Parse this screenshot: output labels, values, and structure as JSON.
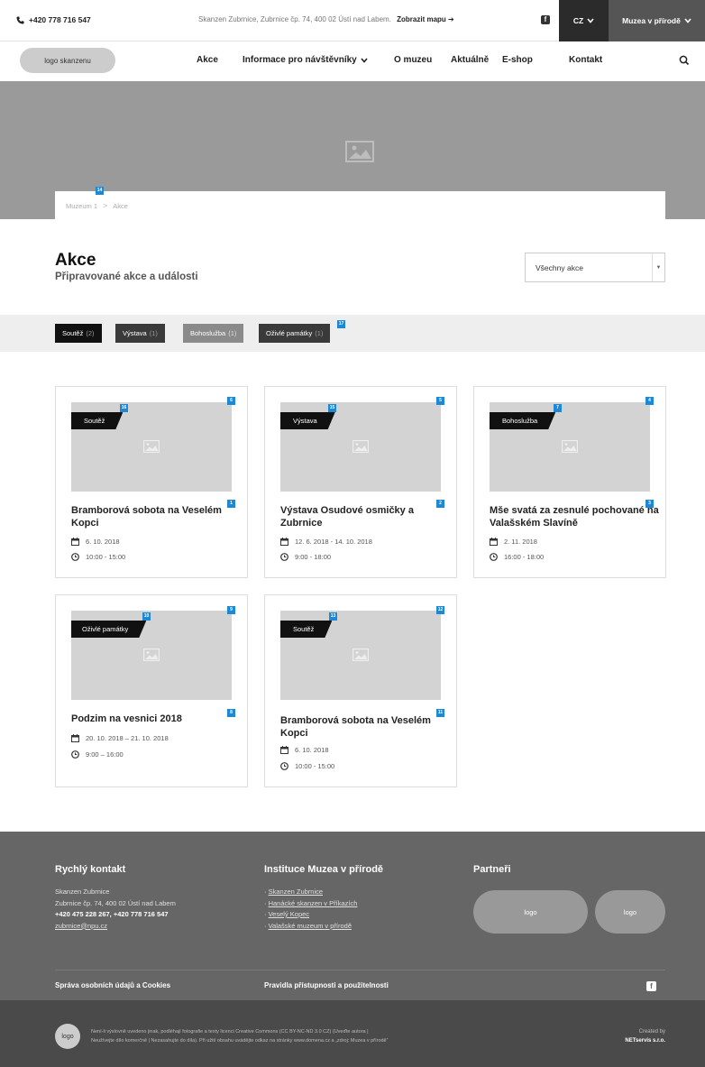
{
  "topbar": {
    "phone": "+420 778 716 547",
    "address": "Skanzen Zubrnice, Zubrnice čp. 74, 400 02 Ústí nad Labem.",
    "map_link": "Zobrazit mapu",
    "language": "CZ",
    "network": "Muzea v přírodě"
  },
  "nav": {
    "logo": "logo skanzenu",
    "items": [
      "Akce",
      "Informace pro návštěvníky",
      "O muzeu",
      "Aktuálně",
      "E-shop",
      "Kontakt"
    ]
  },
  "breadcrumb": {
    "home": "Muzeum 1",
    "current": "Akce"
  },
  "page": {
    "title": "Akce",
    "subtitle": "Připravované akce a události",
    "filter_select": "Všechny akce"
  },
  "filters": [
    {
      "label": "Soutěž",
      "count": "(2)"
    },
    {
      "label": "Výstava",
      "count": "(1)"
    },
    {
      "label": "Bohoslužba",
      "count": "(1)"
    },
    {
      "label": "Oživlé památky",
      "count": "(1)"
    }
  ],
  "events": [
    {
      "category": "Soutěž",
      "title": "Bramborová sobota na Veselém Kopci",
      "date": "6. 10. 2018",
      "time": "10:00 - 15:00"
    },
    {
      "category": "Výstava",
      "title": "Výstava Osudové osmičky a Zubrnice",
      "date": "12. 6. 2018 - 14. 10. 2018",
      "time": "9:00 - 18:00"
    },
    {
      "category": "Bohoslužba",
      "title": "Mše svatá za zesnulé pochované na Valašském Slavíně",
      "date": "2. 11. 2018",
      "time": "16:00 - 18:00"
    },
    {
      "category": "Oživlé památky",
      "title": "Podzim na vesnici 2018",
      "date": "20. 10. 2018 – 21. 10. 2018",
      "time": "9:00 – 16:00"
    },
    {
      "category": "Soutěž",
      "title": "Bramborová sobota na Veselém Kopci",
      "date": "6. 10. 2018",
      "time": "10:00 - 15:00"
    }
  ],
  "badges": [
    "14",
    "16",
    "6",
    "1",
    "15",
    "5",
    "2",
    "7",
    "4",
    "3",
    "10",
    "9",
    "8",
    "13",
    "12",
    "11",
    "17"
  ],
  "footer": {
    "contact_heading": "Rychlý kontakt",
    "contact_name": "Skanzen Zubrnice",
    "contact_address": "Zubrnice čp. 74, 400 02 Ústí nad Labem",
    "contact_phones": "+420 475 228 267, +420 778 716 547",
    "contact_email": "zubrnice@npu.cz",
    "institutions_heading": "Instituce Muzea v přírodě",
    "institutions": [
      "Skanzen Zubrnice",
      "Hanácké skanzen v Příkazích",
      "Veselý Kopec",
      "Valašské muzeum v přírodě"
    ],
    "partners_heading": "Partneři",
    "partner_logos": [
      "logo",
      "logo"
    ],
    "privacy_link": "Správa osobních údajů a Cookies",
    "accessibility_link": "Pravidla přístupnosti a použitelnosti"
  },
  "bottom": {
    "logo": "logo",
    "license_line1": "Není-li výslovně uvedeno jinak, podléhají fotografie a texty licenci Creative Commons (CC BY-NC-ND 3.0 CZ) (Uveďte autora |",
    "license_line2": "Neužívejte dílo komerčně | Nezasahujte do díla). Při užití obsahu uvádějte odkaz na stránky www.domena.cz a „zdroj: Muzea v přírodě“",
    "created_by_label": "Created by",
    "created_by": "NETservis s.r.o."
  },
  "colors": {
    "badge": "#1e88d4",
    "hero": "#9a9a9a",
    "footer": "#666666",
    "bottom_bar": "#4a4a4a"
  }
}
